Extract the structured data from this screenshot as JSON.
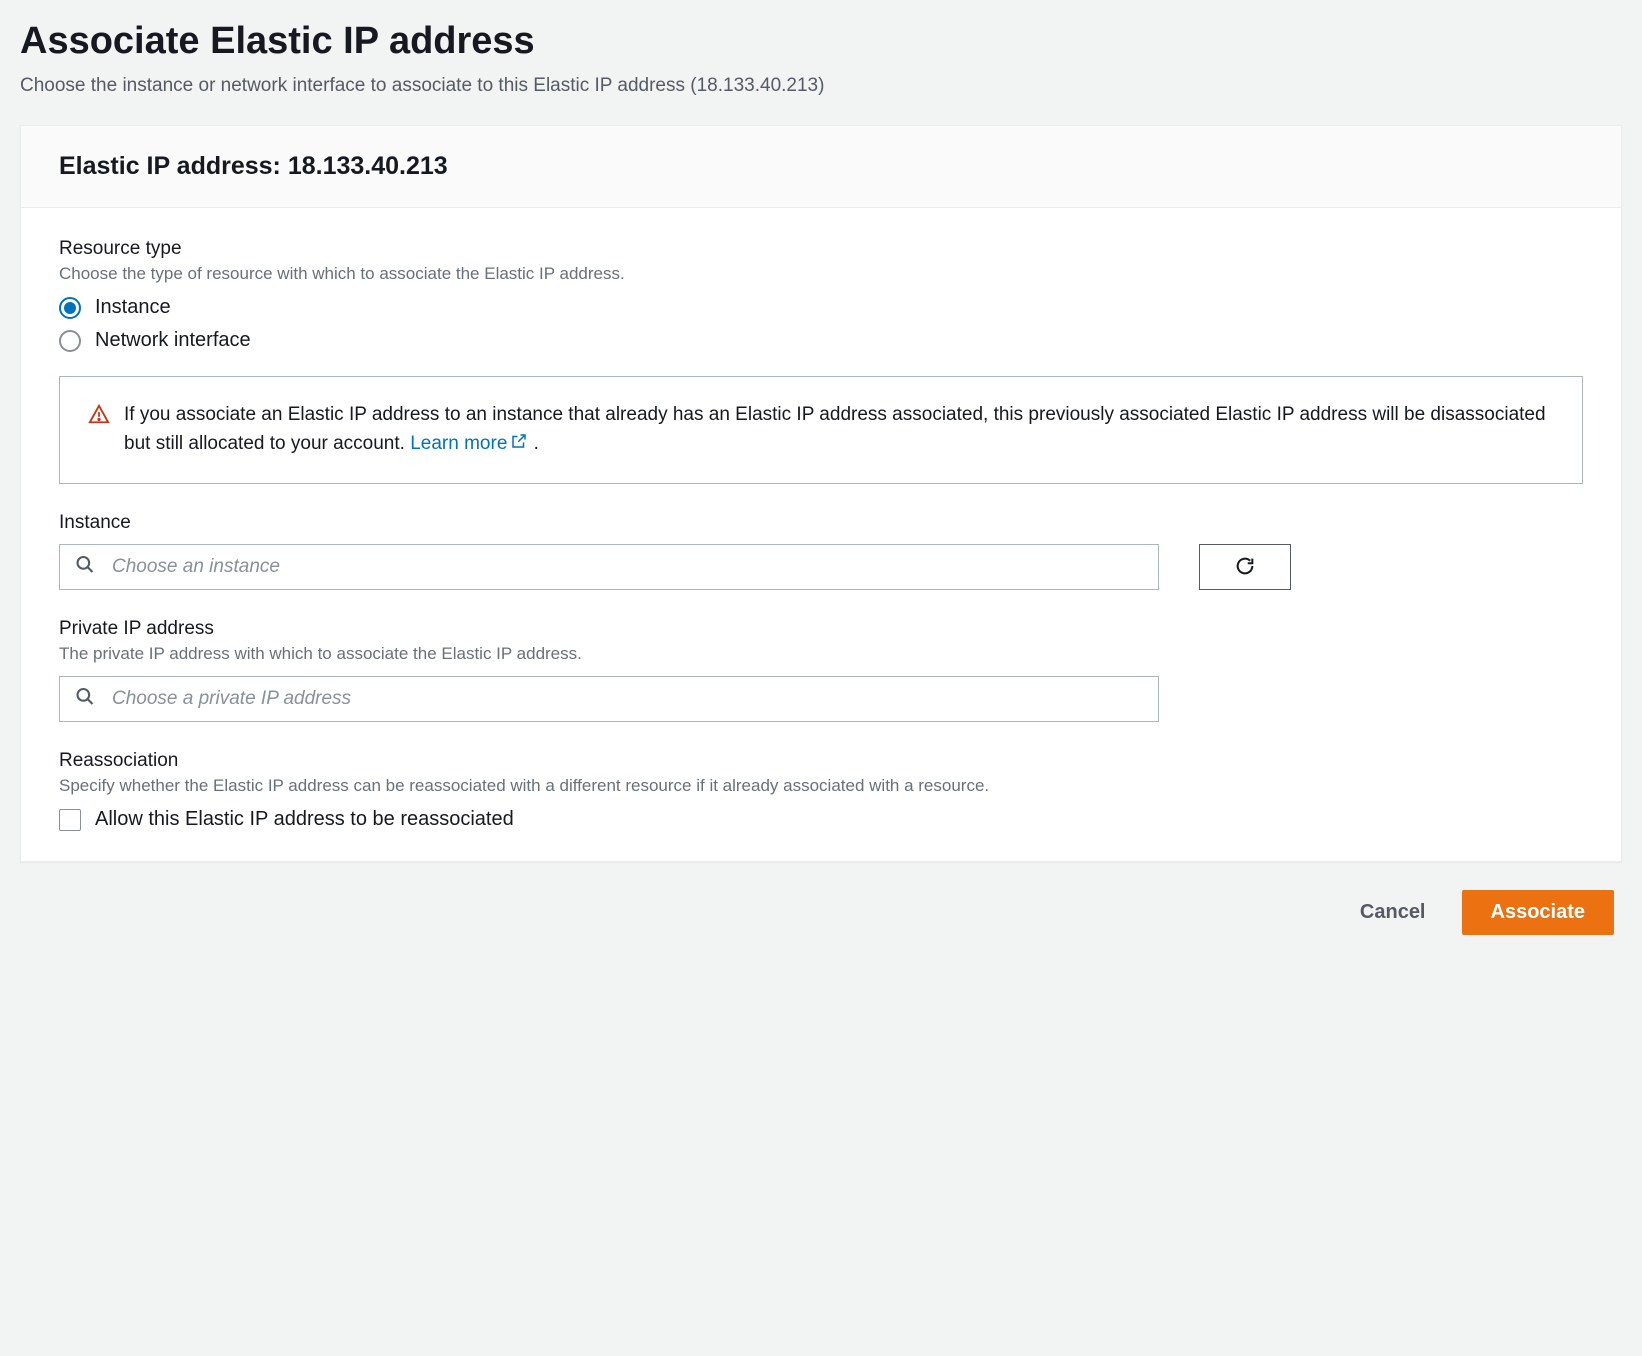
{
  "page": {
    "title": "Associate Elastic IP address",
    "subtitle": "Choose the instance or network interface to associate to this Elastic IP address (18.133.40.213)"
  },
  "panel": {
    "header_prefix": "Elastic IP address: ",
    "ip": "18.133.40.213"
  },
  "resource_type": {
    "title": "Resource type",
    "desc": "Choose the type of resource with which to associate the Elastic IP address.",
    "options": {
      "instance": "Instance",
      "network_interface": "Network interface"
    },
    "selected": "instance"
  },
  "warning": {
    "text": "If you associate an Elastic IP address to an instance that already has an Elastic IP address associated, this previously associated Elastic IP address will be disassociated but still allocated to your account. ",
    "link_label": "Learn more",
    "trailing": " ."
  },
  "instance_field": {
    "label": "Instance",
    "placeholder": "Choose an instance"
  },
  "private_ip_field": {
    "label": "Private IP address",
    "desc": "The private IP address with which to associate the Elastic IP address.",
    "placeholder": "Choose a private IP address"
  },
  "reassociation": {
    "title": "Reassociation",
    "desc": "Specify whether the Elastic IP address can be reassociated with a different resource if it already associated with a resource.",
    "checkbox_label": "Allow this Elastic IP address to be reassociated"
  },
  "footer": {
    "cancel": "Cancel",
    "associate": "Associate"
  }
}
